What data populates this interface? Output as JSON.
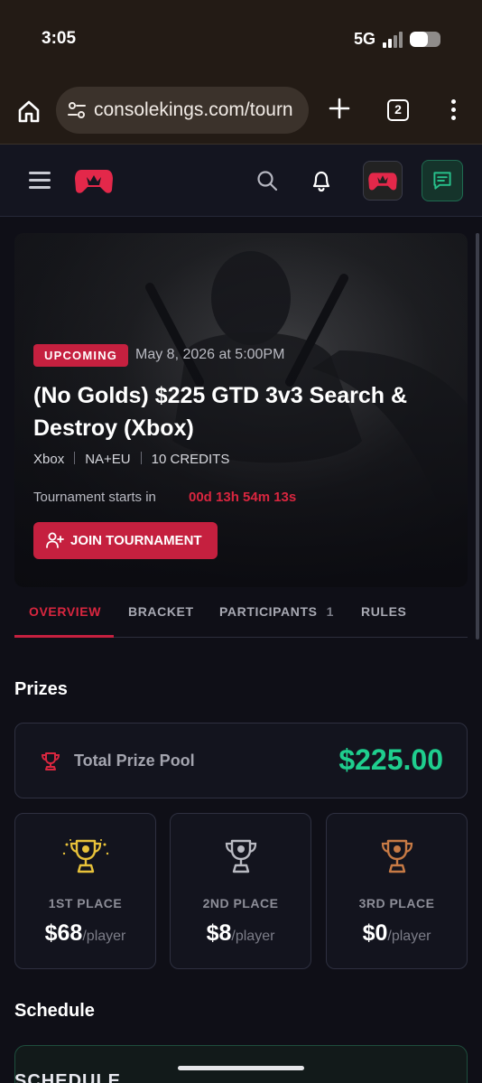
{
  "status_bar": {
    "time": "3:05",
    "network": "5G",
    "battery_level": 0.6
  },
  "browser": {
    "url": "consolekings.com/tourn",
    "tab_count": "2",
    "icons": [
      "home-icon",
      "site-settings-icon",
      "plus-icon",
      "menu-dots-icon"
    ]
  },
  "header": {
    "icons": [
      "hamburger-icon",
      "consolekings-logo",
      "search-icon",
      "bell-icon",
      "avatar",
      "chat-icon"
    ]
  },
  "hero": {
    "badge": "UPCOMING",
    "date": "May 8, 2026 at 5:00PM",
    "title": "(No Golds) $225 GTD 3v3 Search & Destroy (Xbox)",
    "meta": [
      "Xbox",
      "NA+EU",
      "10 CREDITS"
    ],
    "countdown_label": "Tournament starts in",
    "countdown_value": "00d 13h 54m 13s",
    "join_label": "JOIN TOURNAMENT"
  },
  "tabs": [
    {
      "label": "OVERVIEW",
      "active": true
    },
    {
      "label": "BRACKET",
      "active": false
    },
    {
      "label": "PARTICIPANTS",
      "count": "1",
      "active": false
    },
    {
      "label": "RULES",
      "active": false
    }
  ],
  "prizes": {
    "section_title": "Prizes",
    "total_label": "Total Prize Pool",
    "total_value": "$225.00",
    "places": [
      {
        "label": "1ST PLACE",
        "amount": "$68",
        "unit": "/player",
        "color": "#e8c23a"
      },
      {
        "label": "2ND PLACE",
        "amount": "$8",
        "unit": "/player",
        "color": "#b9bac2"
      },
      {
        "label": "3RD PLACE",
        "amount": "$0",
        "unit": "/player",
        "color": "#c77a45"
      }
    ]
  },
  "schedule": {
    "section_title": "Schedule",
    "peek_text": "SCHEDULE"
  },
  "colors": {
    "accent": "#c5203f",
    "money": "#1fce8e",
    "countdown": "#d9263f"
  }
}
